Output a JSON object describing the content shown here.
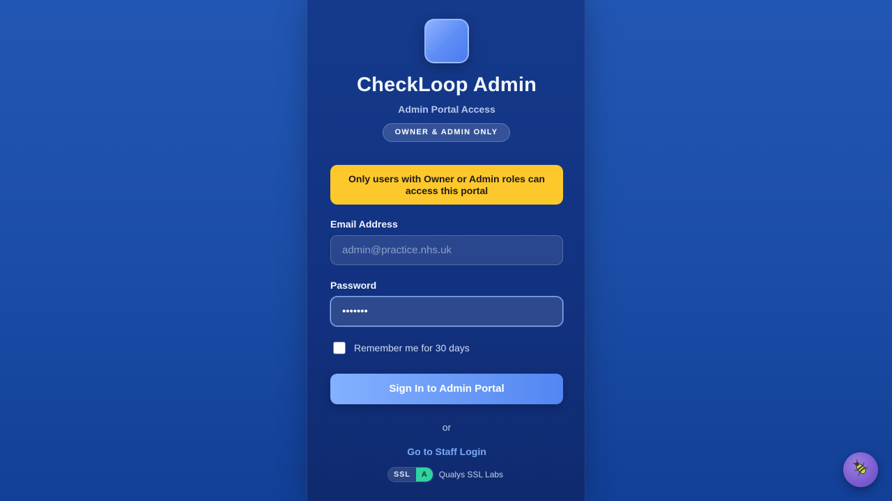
{
  "app": {
    "title": "CheckLoop Admin",
    "subtitle": "Admin Portal Access",
    "badge": "OWNER & ADMIN ONLY"
  },
  "warning": {
    "text": "Only users with Owner or Admin roles can access this portal"
  },
  "form": {
    "email_label": "Email Address",
    "email_placeholder": "admin@practice.nhs.uk",
    "email_value": "",
    "password_label": "Password",
    "password_value": "•••••••",
    "remember_label": "Remember me for 30 days",
    "remember_checked": false,
    "submit_label": "Sign In to Admin Portal"
  },
  "alt": {
    "or_text": "or",
    "staff_link": "Go to Staff Login"
  },
  "ssl": {
    "label": "SSL",
    "grade": "A",
    "provider": "Qualys SSL Labs"
  },
  "floating_action": {
    "icon": "bug-icon"
  },
  "colors": {
    "accent": "#5286f2",
    "warning": "#fdc82b",
    "ssl_grade": "#2ed3a0",
    "link": "#79aaf7"
  }
}
